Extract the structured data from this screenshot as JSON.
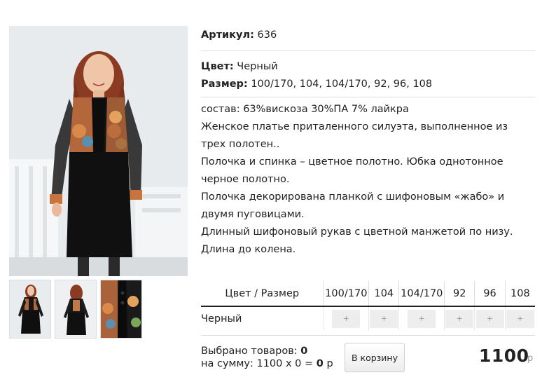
{
  "product": {
    "article_label": "Артикул:",
    "article_value": "636",
    "color_label": "Цвет:",
    "color_value": "Черный",
    "size_label": "Размер:",
    "size_value": "100/170, 104, 104/170, 92, 96, 108"
  },
  "description": [
    "состав: 63%вискоза 30%ПА 7% лайкра",
    "Женское платье приталенного силуэта, выполненное из трех полотен..",
    "Полочка и спинка –  цветное полотно. Юбка однотонное черное полотно.",
    "Полочка декорирована планкой с шифоновым «жабо» и двумя пуговицами.",
    "Длинный шифоновый рукав с цветной манжетой по низу.",
    "Длина до колена."
  ],
  "size_table": {
    "header": "Цвет / Размер",
    "sizes": [
      "100/170",
      "104",
      "104/170",
      "92",
      "96",
      "108"
    ],
    "row_color": "Черный",
    "cell_label": "+"
  },
  "summary": {
    "selected_label": "Выбрано товаров:",
    "selected_count": "0",
    "sum_label": "на сумму: 1100 х 0 =",
    "sum_value": "0",
    "sum_currency": "р"
  },
  "cart_button": "В корзину",
  "price": "1100",
  "currency": "р",
  "colors": {
    "dress": "#111111",
    "floral_accent": "#c9733f",
    "hair": "#8a3b22",
    "background": "#e9ecee"
  }
}
